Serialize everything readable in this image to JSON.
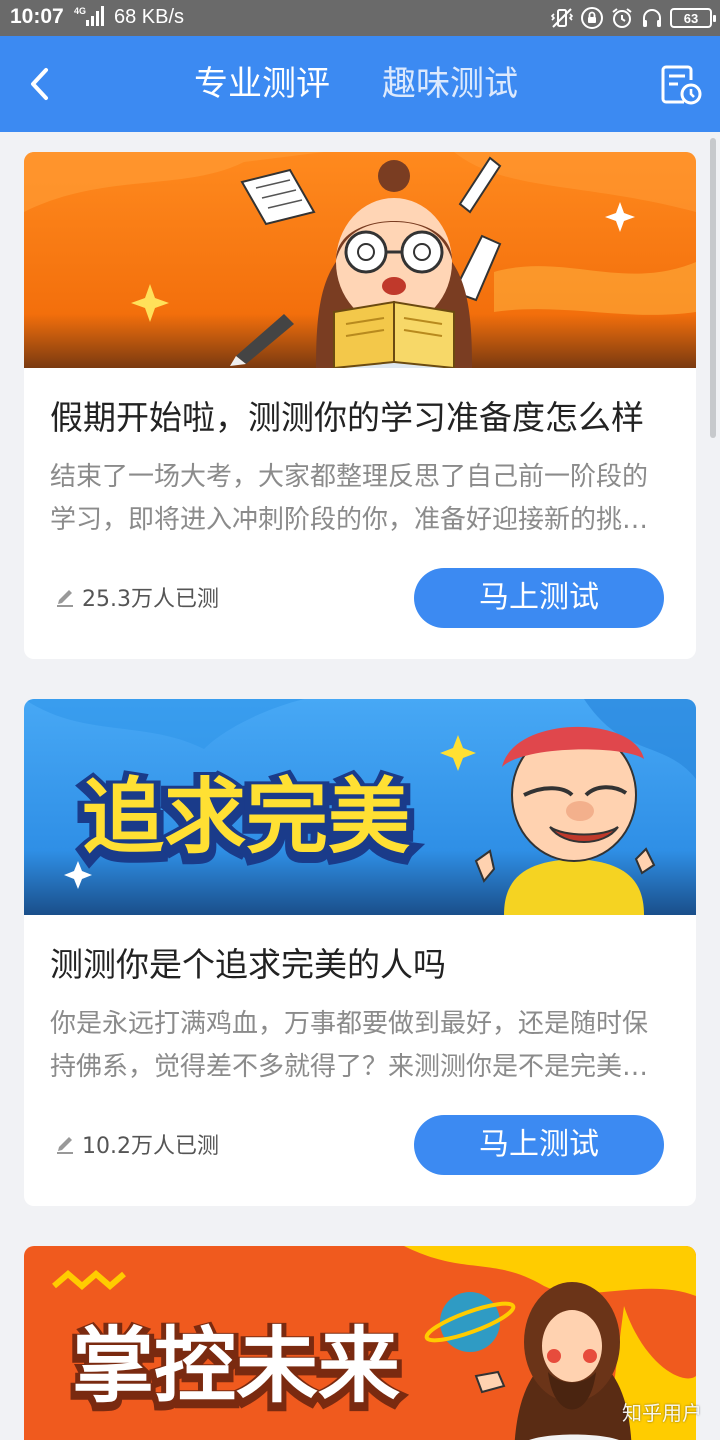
{
  "status_bar": {
    "time": "10:07",
    "net_label": "4G",
    "speed": "68 KB/s",
    "battery": "63"
  },
  "header": {
    "tabs": [
      {
        "label": "专业测评",
        "active": true
      },
      {
        "label": "趣味测试",
        "active": false
      }
    ]
  },
  "cards": [
    {
      "title": "假期开始啦，测测你的学习准备度怎么样",
      "description": "结束了一场大考，大家都整理反思了自己前一阶段的学习，即将进入冲刺阶段的你，准备好迎接新的挑战了吗？",
      "count": "25.3万人已测",
      "button": "马上测试",
      "banner_colors": [
        "#ff7f1a",
        "#f5d14a"
      ]
    },
    {
      "title": "测测你是个追求完美的人吗",
      "description": "你是永远打满鸡血，万事都要做到最好，还是随时保持佛系，觉得差不多就得了？来测测你是不是完美主义者吧",
      "count": "10.2万人已测",
      "button": "马上测试",
      "banner_title": "追求完美",
      "banner_colors": [
        "#3fa0f2",
        "#ffe033"
      ]
    },
    {
      "banner_title": "掌控未来",
      "banner_colors": [
        "#f05a1e",
        "#ffcc00"
      ]
    }
  ],
  "watermark": "知乎用户",
  "colors": {
    "accent": "#3c8af2",
    "page_bg": "#f1f2f5",
    "status_bar": "#6a6a6a"
  }
}
